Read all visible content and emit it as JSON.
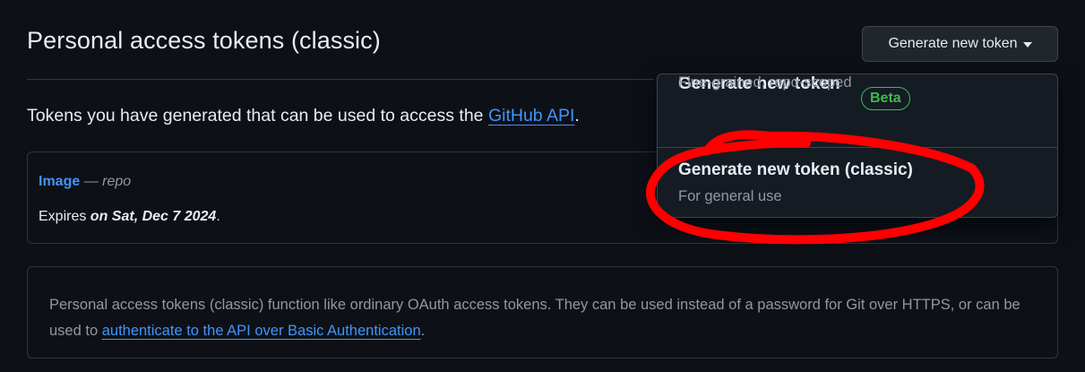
{
  "header": {
    "title": "Personal access tokens (classic)",
    "generate_button_label": "Generate new token"
  },
  "intro": {
    "text_before": "Tokens you have generated that can be used to access the ",
    "link_text": "GitHub API",
    "text_after": "."
  },
  "token": {
    "name": "Image",
    "separator": " — ",
    "scope": "repo",
    "expires_prefix": "Expires ",
    "expires_date": "on Sat, Dec 7 2024",
    "expires_suffix": "."
  },
  "info": {
    "text_before": "Personal access tokens (classic) function like ordinary OAuth access tokens. They can be used instead of a password for Git over HTTPS, or can be used to ",
    "link_text": "authenticate to the API over Basic Authentication",
    "text_after": "."
  },
  "dropdown": {
    "items": [
      {
        "title": "Generate new token",
        "badge": "Beta",
        "description": "Fine-grained, repo-scoped"
      },
      {
        "title": "Generate new token (classic)",
        "description": "For general use"
      }
    ]
  },
  "colors": {
    "background": "#0d1117",
    "link": "#4493f8",
    "beta_badge": "#3fb950",
    "annotation": "#ff0000"
  },
  "icons": {
    "dropdown_caret": "caret-down-icon"
  }
}
